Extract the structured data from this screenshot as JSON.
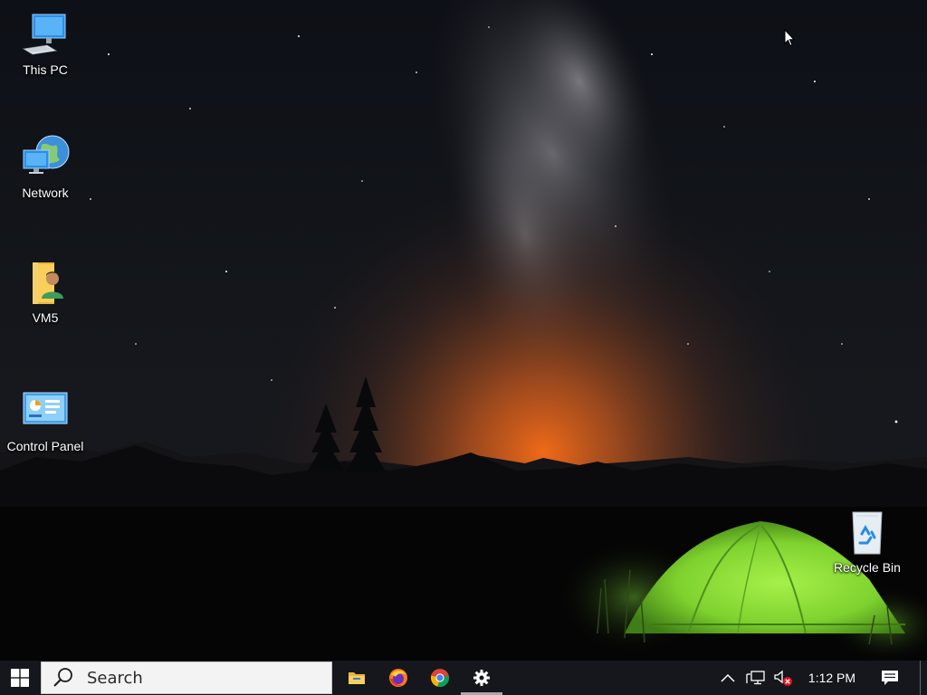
{
  "desktop_icons": [
    {
      "name": "this-pc",
      "label": "This PC",
      "icon": "computer-icon"
    },
    {
      "name": "network",
      "label": "Network",
      "icon": "network-globe-icon"
    },
    {
      "name": "vm5",
      "label": "VM5",
      "icon": "user-folder-icon"
    },
    {
      "name": "control-panel",
      "label": "Control Panel",
      "icon": "control-panel-icon"
    },
    {
      "name": "recycle-bin",
      "label": "Recycle Bin",
      "icon": "recycle-bin-icon"
    }
  ],
  "taskbar": {
    "start_icon": "windows-logo-icon",
    "search": {
      "placeholder": "Search",
      "icon": "search-icon"
    },
    "pinned_apps": [
      {
        "name": "file-explorer",
        "icon": "folder-icon",
        "active": false
      },
      {
        "name": "firefox",
        "icon": "firefox-icon",
        "active": false
      },
      {
        "name": "chrome",
        "icon": "chrome-icon",
        "active": false
      },
      {
        "name": "settings",
        "icon": "gear-icon",
        "active": true
      }
    ],
    "tray": {
      "overflow_icon": "chevron-up-icon",
      "network_icon": "network-monitor-icon",
      "volume_icon": "volume-muted-icon",
      "clock": "1:12 PM",
      "notifications_icon": "notification-icon"
    }
  },
  "colors": {
    "taskbar_bg": "#15171c",
    "search_bg": "#f3f3f3",
    "tent_green": "#8fe23a",
    "horizon_glow": "#e8661c"
  }
}
